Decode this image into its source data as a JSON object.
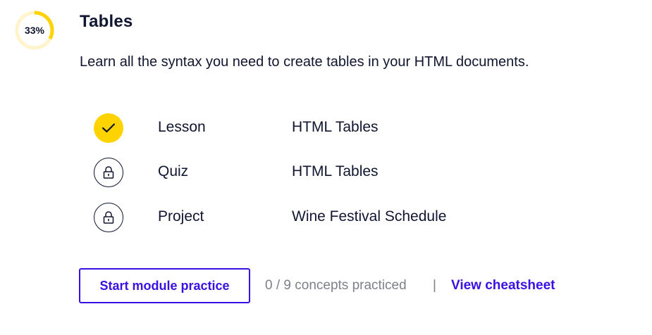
{
  "module": {
    "progress_label": "33%",
    "progress_fraction": 0.33,
    "title": "Tables",
    "description": "Learn all the syntax you need to create tables in your HTML documents."
  },
  "items": [
    {
      "type": "Lesson",
      "name": "HTML Tables",
      "status": "completed",
      "icon": "check-icon"
    },
    {
      "type": "Quiz",
      "name": "HTML Tables",
      "status": "locked",
      "icon": "lock-icon"
    },
    {
      "type": "Project",
      "name": "Wine Festival Schedule",
      "status": "locked",
      "icon": "lock-icon"
    }
  ],
  "footer": {
    "practice_button": "Start module practice",
    "concepts_status": "0 / 9 concepts practiced",
    "separator": "|",
    "cheatsheet_link": "View cheatsheet"
  },
  "colors": {
    "accent": "#3a10e5",
    "progress": "#ffd300",
    "progress_track": "#fff4cc",
    "text": "#10162f",
    "muted": "#7d8089"
  }
}
